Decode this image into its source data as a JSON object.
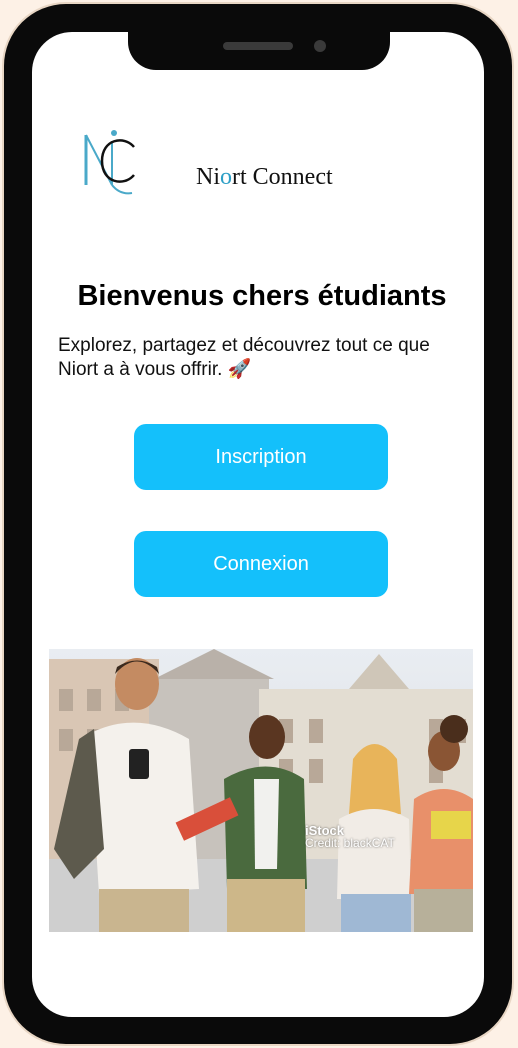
{
  "app": {
    "brand_prefix": "Ni",
    "brand_o": "o",
    "brand_suffix": "rt Connect"
  },
  "welcome": {
    "title": "Bienvenus chers étudiants",
    "subtitle": "Explorez, partagez et découvrez tout ce que Niort a à vous offrir. 🚀"
  },
  "actions": {
    "signup_label": "Inscription",
    "login_label": "Connexion"
  },
  "hero_image": {
    "watermark_brand": "iStock",
    "watermark_credit": "Credit: blackCAT"
  },
  "colors": {
    "accent": "#14c0fb",
    "brand_o": "#2d9fc6",
    "frame": "#0a0a0a"
  },
  "icons": {
    "rocket": "rocket-icon"
  }
}
